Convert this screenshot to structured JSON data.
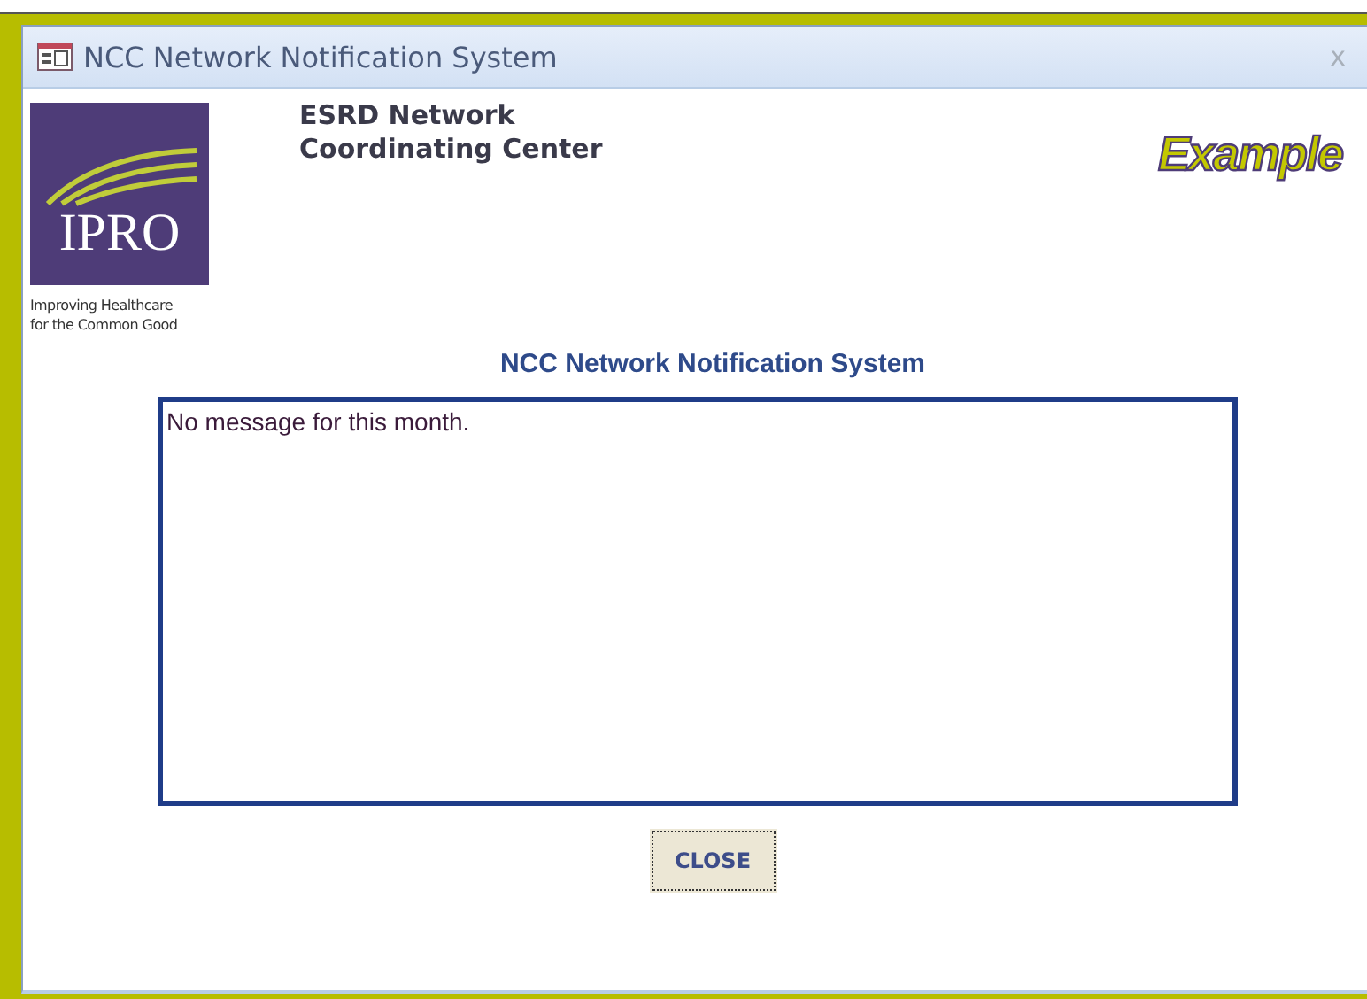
{
  "window": {
    "title": "NCC Network Notification System",
    "close_glyph": "x"
  },
  "logo": {
    "text": "IPRO",
    "tagline": [
      "Improving Healthcare",
      "for the Common Good"
    ]
  },
  "organization": [
    "ESRD Network",
    "Coordinating Center"
  ],
  "stamp": "Example",
  "heading": "NCC Network Notification System",
  "message": "No message for this month.",
  "buttons": [
    "CLOSE"
  ]
}
